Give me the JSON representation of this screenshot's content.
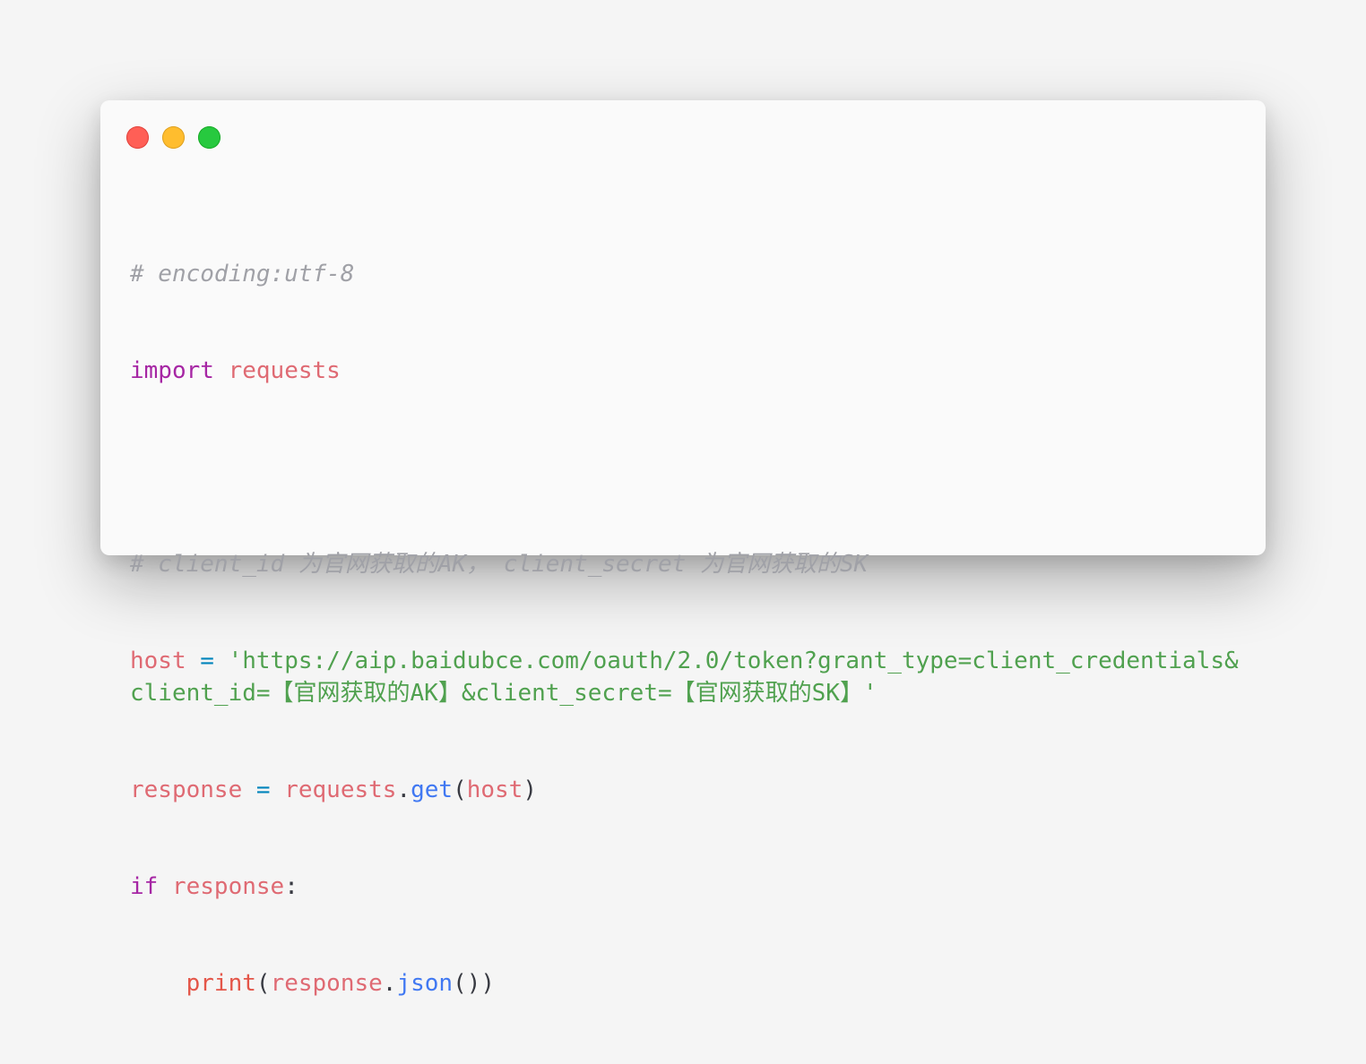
{
  "window": {
    "controls": [
      "close",
      "minimize",
      "maximize"
    ]
  },
  "colors": {
    "background": "#f5f5f5",
    "window": "#fafafa",
    "comment": "#a0a1a7",
    "keyword": "#a626a4",
    "variable": "#df6a73",
    "operator": "#0184bc",
    "string": "#50a14f",
    "function": "#4078f2"
  },
  "code": {
    "line1_comment": "# encoding:utf-8",
    "line2_keyword": "import",
    "line2_module": "requests",
    "line4_comment": "# client_id 为官网获取的AK， client_secret 为官网获取的SK",
    "line5_var": "host",
    "line5_op": "=",
    "line5_string": "'https://aip.baidubce.com/oauth/2.0/token?grant_type=client_credentials&client_id=【官网获取的AK】&client_secret=【官网获取的SK】'",
    "line6_var": "response",
    "line6_op": "=",
    "line6_module": "requests",
    "line6_dot": ".",
    "line6_fn": "get",
    "line6_open": "(",
    "line6_arg": "host",
    "line6_close": ")",
    "line7_keyword": "if",
    "line7_var": "response",
    "line7_colon": ":",
    "line8_indent": "    ",
    "line8_fn": "print",
    "line8_open": "(",
    "line8_var": "response",
    "line8_dot": ".",
    "line8_method": "json",
    "line8_close": "())"
  }
}
